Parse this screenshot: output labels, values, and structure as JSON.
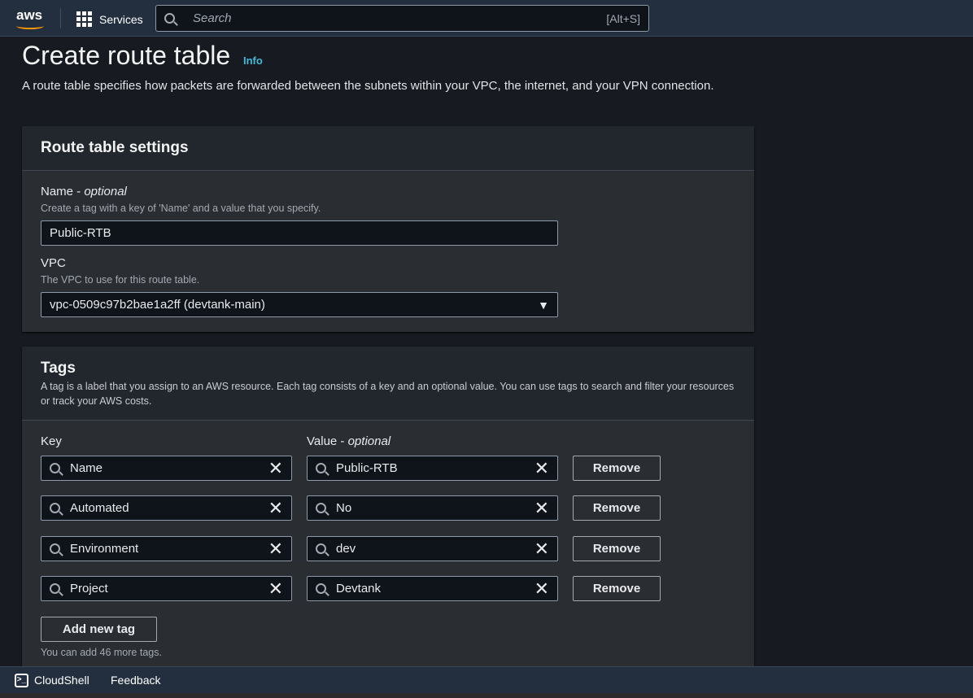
{
  "nav": {
    "logo": "aws",
    "services": "Services",
    "search_placeholder": "Search",
    "search_shortcut": "[Alt+S]"
  },
  "page": {
    "title": "Create route table",
    "info": "Info",
    "description": "A route table specifies how packets are forwarded between the subnets within your VPC, the internet, and your VPN connection."
  },
  "settings": {
    "title": "Route table settings",
    "name_label": "Name - ",
    "name_optional": "optional",
    "name_hint": "Create a tag with a key of 'Name' and a value that you specify.",
    "name_value": "Public-RTB",
    "vpc_label": "VPC",
    "vpc_hint": "The VPC to use for this route table.",
    "vpc_value": "vpc-0509c97b2bae1a2ff (devtank-main)"
  },
  "tags": {
    "title": "Tags",
    "description": "A tag is a label that you assign to an AWS resource. Each tag consists of a key and an optional value. You can use tags to search and filter your resources or track your AWS costs.",
    "key_label": "Key",
    "value_label": "Value - ",
    "value_optional": "optional",
    "rows": [
      {
        "key": "Name",
        "value": "Public-RTB"
      },
      {
        "key": "Automated",
        "value": "No"
      },
      {
        "key": "Environment",
        "value": "dev"
      },
      {
        "key": "Project",
        "value": "Devtank"
      }
    ],
    "remove_label": "Remove",
    "add_label": "Add new tag",
    "remaining": "You can add 46 more tags."
  },
  "footer": {
    "cloudshell": "CloudShell",
    "feedback": "Feedback"
  }
}
